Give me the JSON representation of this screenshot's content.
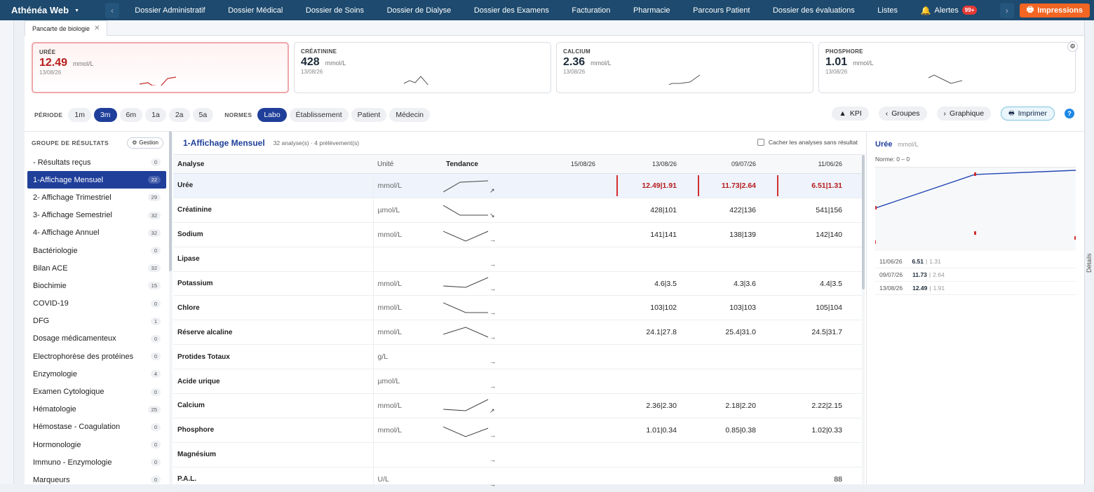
{
  "app": {
    "title": "Athénéa Web"
  },
  "nav": {
    "items": [
      "Dossier Administratif",
      "Dossier Médical",
      "Dossier de Soins",
      "Dossier de Dialyse",
      "Dossier des Examens",
      "Facturation",
      "Pharmacie",
      "Parcours Patient",
      "Dossier des évaluations",
      "Listes"
    ],
    "alerts_label": "Alertes",
    "alerts_badge": "99+",
    "impressions_label": "Impressions"
  },
  "tab": {
    "label": "Pancarte de biologie"
  },
  "kpis": [
    {
      "label": "URÉE",
      "value": "12.49",
      "unit": "mmol/L",
      "date": "13/08/26"
    },
    {
      "label": "CRÉATININE",
      "value": "428",
      "unit": "mmol/L",
      "date": "13/08/26"
    },
    {
      "label": "CALCIUM",
      "value": "2.36",
      "unit": "mmol/L",
      "date": "13/08/26"
    },
    {
      "label": "PHOSPHORE",
      "value": "1.01",
      "unit": "mmol/L",
      "date": "13/08/26"
    }
  ],
  "filters": {
    "periode_label": "PÉRIODE",
    "periods": [
      "1m",
      "3m",
      "6m",
      "1a",
      "2a",
      "5a"
    ],
    "periode_selected": "3m",
    "normes_label": "NORMES",
    "normes": [
      "Labo",
      "Établissement",
      "Patient",
      "Médecin"
    ],
    "normes_selected": "Labo",
    "kpi_label": "KPI",
    "groupes_label": "Groupes",
    "graphique_label": "Graphique",
    "imprimer_label": "Imprimer",
    "help": "?"
  },
  "sidebar": {
    "title": "GROUPE DE RÉSULTATS",
    "gestion_label": "Gestion",
    "items": [
      {
        "label": "- Résultats reçus",
        "count": "0"
      },
      {
        "label": "1-Affichage Mensuel",
        "count": "22"
      },
      {
        "label": "2- Affichage Trimestriel",
        "count": "29"
      },
      {
        "label": "3- Affichage Semestriel",
        "count": "32"
      },
      {
        "label": "4- Affichage Annuel",
        "count": "32"
      },
      {
        "label": "Bactériologie",
        "count": "0"
      },
      {
        "label": "Bilan ACE",
        "count": "32"
      },
      {
        "label": "Biochimie",
        "count": "15"
      },
      {
        "label": "COVID-19",
        "count": "0"
      },
      {
        "label": "DFG",
        "count": "1"
      },
      {
        "label": "Dosage médicamenteux",
        "count": "0"
      },
      {
        "label": "Electrophorèse des protéines",
        "count": "0"
      },
      {
        "label": "Enzymologie",
        "count": "4"
      },
      {
        "label": "Examen Cytologique",
        "count": "0"
      },
      {
        "label": "Hématologie",
        "count": "25"
      },
      {
        "label": "Hémostase - Coagulation",
        "count": "0"
      },
      {
        "label": "Hormonologie",
        "count": "0"
      },
      {
        "label": "Immuno - Enzymologie",
        "count": "0"
      },
      {
        "label": "Marqueurs",
        "count": "0"
      }
    ]
  },
  "content": {
    "title": "1-Affichage Mensuel",
    "meta": "32 analyse(s) · 4 prélèvement(s)",
    "hide_label": "Cacher les analyses sans résultat",
    "columns": {
      "analyse": "Analyse",
      "unite": "Unité",
      "tendance": "Tendance",
      "dates": [
        "15/08/26",
        "13/08/26",
        "09/07/26",
        "11/06/26"
      ]
    },
    "rows": [
      {
        "name": "Urée",
        "unit": "mmol/L",
        "arrow": "↗",
        "vals": [
          "",
          "12.49|1.91",
          "11.73|2.64",
          "6.51|1.31"
        ],
        "high": true
      },
      {
        "name": "Créatinine",
        "unit": "µmol/L",
        "arrow": "↘",
        "vals": [
          "",
          "428|101",
          "422|136",
          "541|156"
        ]
      },
      {
        "name": "Sodium",
        "unit": "mmol/L",
        "arrow": "→",
        "vals": [
          "",
          "141|141",
          "138|139",
          "142|140"
        ]
      },
      {
        "name": "Lipase",
        "unit": "",
        "arrow": "→",
        "vals": [
          "",
          "",
          "",
          ""
        ]
      },
      {
        "name": "Potassium",
        "unit": "mmol/L",
        "arrow": "→",
        "vals": [
          "",
          "4.6|3.5",
          "4.3|3.6",
          "4.4|3.5"
        ]
      },
      {
        "name": "Chlore",
        "unit": "mmol/L",
        "arrow": "→",
        "vals": [
          "",
          "103|102",
          "103|103",
          "105|104"
        ]
      },
      {
        "name": "Réserve alcaline",
        "unit": "mmol/L",
        "arrow": "→",
        "vals": [
          "",
          "24.1|27.8",
          "25.4|31.0",
          "24.5|31.7"
        ]
      },
      {
        "name": "Protides Totaux",
        "unit": "g/L",
        "arrow": "→",
        "vals": [
          "",
          "",
          "",
          ""
        ]
      },
      {
        "name": "Acide urique",
        "unit": "µmol/L",
        "arrow": "→",
        "vals": [
          "",
          "",
          "",
          ""
        ]
      },
      {
        "name": "Calcium",
        "unit": "mmol/L",
        "arrow": "↗",
        "vals": [
          "",
          "2.36|2.30",
          "2.18|2.20",
          "2.22|2.15"
        ]
      },
      {
        "name": "Phosphore",
        "unit": "mmol/L",
        "arrow": "→",
        "vals": [
          "",
          "1.01|0.34",
          "0.85|0.38",
          "1.02|0.33"
        ]
      },
      {
        "name": "Magnésium",
        "unit": "",
        "arrow": "→",
        "vals": [
          "",
          "",
          "",
          ""
        ]
      },
      {
        "name": "P.A.L.",
        "unit": "U/L",
        "arrow": "→",
        "vals": [
          "",
          "",
          "",
          "88"
        ]
      }
    ]
  },
  "detail": {
    "title": "Urée",
    "unit": "mmol/L",
    "norme": "Norme: 0 – 0",
    "side_label": "Détails",
    "entries": [
      {
        "date": "11/06/26",
        "value": "6.51",
        "sub": "1.31"
      },
      {
        "date": "09/07/26",
        "value": "11.73",
        "sub": "2.64"
      },
      {
        "date": "13/08/26",
        "value": "12.49",
        "sub": "1.91"
      }
    ]
  },
  "colors": {
    "topbar": "#1d4a6e",
    "accent": "#1f3f9a",
    "alert": "#b71c1c",
    "impressions": "#f26522"
  }
}
